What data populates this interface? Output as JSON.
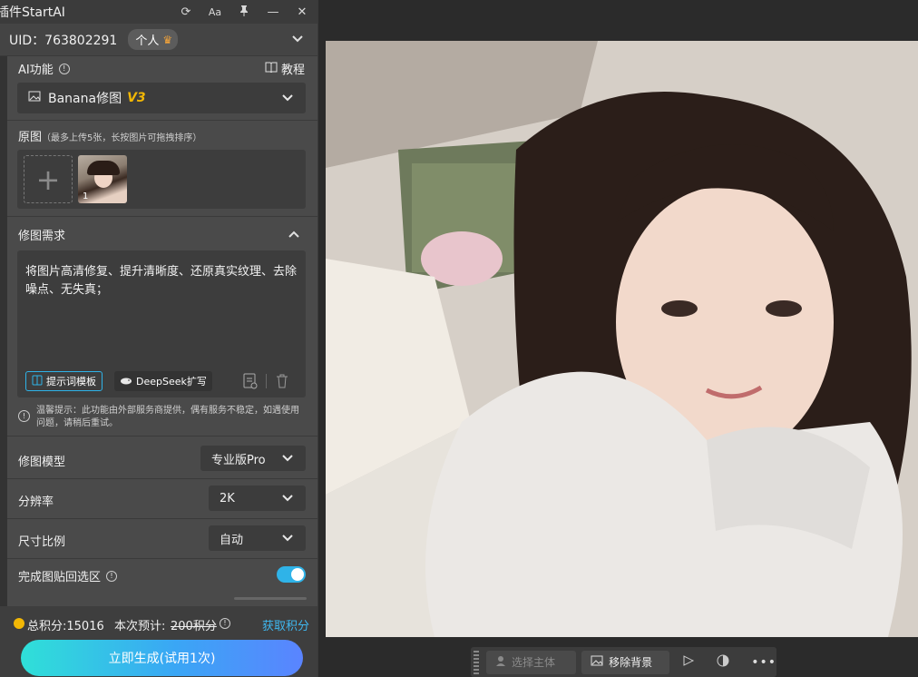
{
  "window": {
    "title": "插件StartAI"
  },
  "titlebar_icons": [
    "refresh-icon",
    "font-size-icon",
    "pin-icon",
    "minimize-icon",
    "close-icon"
  ],
  "account": {
    "uid_label": "UID：763802291",
    "plan": "个人"
  },
  "ai": {
    "label": "AI功能",
    "tutorial": "教程",
    "selected": "Banana修图",
    "version": "V3"
  },
  "original": {
    "label": "原图",
    "hint": "（最多上传5张，长按图片可拖拽排序）",
    "thumb_index": "1"
  },
  "request": {
    "label": "修图需求",
    "text": "将图片高清修复、提升清晰度、还原真实纹理、去除噪点、无失真；",
    "template_btn": "提示词模板",
    "deepseek_btn": "DeepSeek扩写"
  },
  "notice": "温馨提示：此功能由外部服务商提供，偶有服务不稳定，如遇使用问题，请稍后重试。",
  "settings": [
    {
      "label": "修图模型",
      "value": "专业版Pro"
    },
    {
      "label": "分辨率",
      "value": "2K"
    },
    {
      "label": "尺寸比例",
      "value": "自动"
    }
  ],
  "paste_back": {
    "label": "完成图贴回选区",
    "enabled": true
  },
  "points": {
    "total": "总积分:15016",
    "estimate_label": "本次预计:",
    "estimate_value": "200积分",
    "get": "获取积分"
  },
  "generate_btn": "立即生成(试用1次)",
  "toolbar": {
    "select_subject": "选择主体",
    "remove_bg": "移除背景"
  },
  "colors": {
    "accent": "#2fb3e8",
    "version": "#f2b705",
    "link": "#3fb8f0"
  }
}
